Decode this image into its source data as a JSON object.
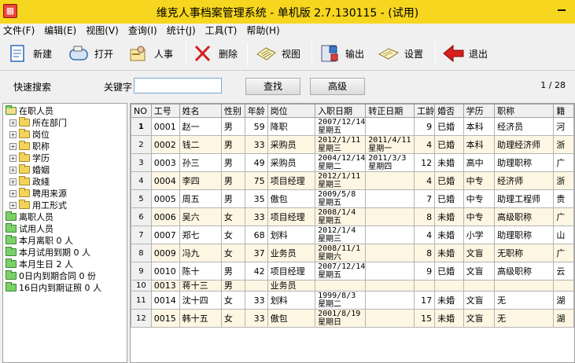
{
  "window": {
    "title": "维克人事档案管理系统 - 单机版 2.7.130115 - (试用)"
  },
  "menu": [
    "文件(F)",
    "编辑(E)",
    "视图(V)",
    "查询(I)",
    "统计(J)",
    "工具(T)",
    "帮助(H)"
  ],
  "toolbar": {
    "new": "新建",
    "open": "打开",
    "person": "人事",
    "delete": "删除",
    "view": "视图",
    "export": "输出",
    "settings": "设置",
    "exit": "退出"
  },
  "search": {
    "quick_label": "快速搜索",
    "keyword_label": "关键字",
    "keyword_value": "",
    "find_button": "查找",
    "advanced_button": "高级",
    "page_indicator": "1 / 28"
  },
  "tree": {
    "root": "在职人员",
    "children": [
      "所在部门",
      "岗位",
      "职称",
      "学历",
      "婚姻",
      "政綫",
      "聘用来源",
      "用工形式"
    ],
    "others": [
      "离职人员",
      "试用人员",
      "本月离职 0 人",
      "本月试用到期 0 人",
      "本月生日 2 人",
      "0日内到期合同 0 份",
      "16日内到期证照 0 人"
    ]
  },
  "grid": {
    "columns": [
      "NO",
      "工号",
      "姓名",
      "性别",
      "年龄",
      "岗位",
      "入职日期",
      "转正日期",
      "工龄",
      "婚否",
      "学历",
      "职称",
      "籍"
    ],
    "rows": [
      {
        "no": "1",
        "id": "0001",
        "name": "赵一",
        "sex": "男",
        "age": "59",
        "post": "降职",
        "join": "2007/12/14",
        "join_wd": "星期五",
        "reg": "",
        "reg_wd": "",
        "years": "9",
        "married": "已婚",
        "edu": "本科",
        "title": "经济员",
        "origin": "河"
      },
      {
        "no": "2",
        "id": "0002",
        "name": "钱二",
        "sex": "男",
        "age": "33",
        "post": "采购员",
        "join": "2012/1/11",
        "join_wd": "星期三",
        "reg": "2011/4/11",
        "reg_wd": "星期一",
        "years": "4",
        "married": "已婚",
        "edu": "本科",
        "title": "助理经济师",
        "origin": "浙"
      },
      {
        "no": "3",
        "id": "0003",
        "name": "孙三",
        "sex": "男",
        "age": "49",
        "post": "采购员",
        "join": "2004/12/14",
        "join_wd": "星期二",
        "reg": "2011/3/3",
        "reg_wd": "星期四",
        "years": "12",
        "married": "未婚",
        "edu": "高中",
        "title": "助理职称",
        "origin": "广"
      },
      {
        "no": "4",
        "id": "0004",
        "name": "李四",
        "sex": "男",
        "age": "75",
        "post": "项目经理",
        "join": "2012/1/11",
        "join_wd": "星期三",
        "reg": "",
        "reg_wd": "",
        "years": "4",
        "married": "已婚",
        "edu": "中专",
        "title": "经济师",
        "origin": "浙"
      },
      {
        "no": "5",
        "id": "0005",
        "name": "周五",
        "sex": "男",
        "age": "35",
        "post": "傲包",
        "join": "2009/5/8",
        "join_wd": "星期五",
        "reg": "",
        "reg_wd": "",
        "years": "7",
        "married": "已婚",
        "edu": "中专",
        "title": "助理工程师",
        "origin": "贵"
      },
      {
        "no": "6",
        "id": "0006",
        "name": "吴六",
        "sex": "女",
        "age": "33",
        "post": "项目经理",
        "join": "2008/1/4",
        "join_wd": "星期五",
        "reg": "",
        "reg_wd": "",
        "years": "8",
        "married": "未婚",
        "edu": "中专",
        "title": "高级职称",
        "origin": "广"
      },
      {
        "no": "7",
        "id": "0007",
        "name": "郑七",
        "sex": "女",
        "age": "68",
        "post": "划料",
        "join": "2012/1/4",
        "join_wd": "星期三",
        "reg": "",
        "reg_wd": "",
        "years": "4",
        "married": "未婚",
        "edu": "小学",
        "title": "助理职称",
        "origin": "山"
      },
      {
        "no": "8",
        "id": "0009",
        "name": "冯九",
        "sex": "女",
        "age": "37",
        "post": "业务员",
        "join": "2008/11/1",
        "join_wd": "星期六",
        "reg": "",
        "reg_wd": "",
        "years": "8",
        "married": "未婚",
        "edu": "文盲",
        "title": "无职称",
        "origin": "广"
      },
      {
        "no": "9",
        "id": "0010",
        "name": "陈十",
        "sex": "男",
        "age": "42",
        "post": "项目经理",
        "join": "2007/12/14",
        "join_wd": "星期五",
        "reg": "",
        "reg_wd": "",
        "years": "9",
        "married": "已婚",
        "edu": "文盲",
        "title": "高级职称",
        "origin": "云"
      },
      {
        "no": "10",
        "id": "0013",
        "name": "蒋十三",
        "sex": "男",
        "age": "",
        "post": "业务员",
        "join": "",
        "join_wd": "",
        "reg": "",
        "reg_wd": "",
        "years": "",
        "married": "",
        "edu": "",
        "title": "",
        "origin": ""
      },
      {
        "no": "11",
        "id": "0014",
        "name": "沈十四",
        "sex": "女",
        "age": "33",
        "post": "划料",
        "join": "1999/8/3",
        "join_wd": "星期二",
        "reg": "",
        "reg_wd": "",
        "years": "17",
        "married": "未婚",
        "edu": "文盲",
        "title": "无",
        "origin": "湖"
      },
      {
        "no": "12",
        "id": "0015",
        "name": "韩十五",
        "sex": "女",
        "age": "33",
        "post": "傲包",
        "join": "2001/8/19",
        "join_wd": "星期日",
        "reg": "",
        "reg_wd": "",
        "years": "15",
        "married": "未婚",
        "edu": "文盲",
        "title": "无",
        "origin": "湖"
      }
    ]
  }
}
